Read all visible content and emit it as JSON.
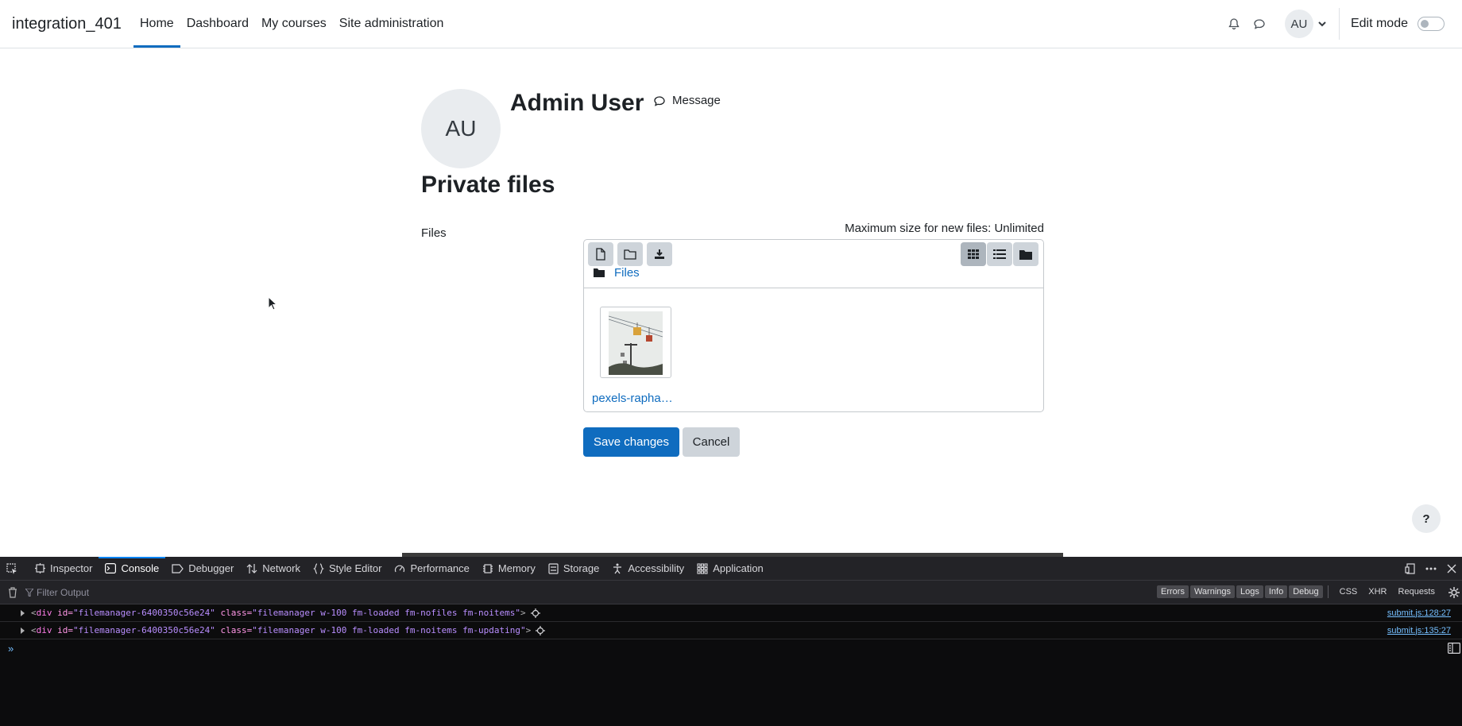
{
  "navbar": {
    "brand": "integration_401",
    "links": [
      "Home",
      "Dashboard",
      "My courses",
      "Site administration"
    ],
    "active_link": "Home",
    "user_initials": "AU",
    "edit_mode_label": "Edit mode",
    "edit_mode_on": false
  },
  "profile": {
    "initials": "AU",
    "name": "Admin User",
    "message_label": "Message"
  },
  "page": {
    "title": "Private files",
    "files_label": "Files",
    "max_size": "Maximum size for new files: Unlimited"
  },
  "filemanager": {
    "breadcrumb": "Files",
    "file_name": "pexels-rapha…",
    "view": "icons"
  },
  "buttons": {
    "save": "Save changes",
    "cancel": "Cancel",
    "help": "?"
  },
  "devtools": {
    "tabs": [
      "Inspector",
      "Console",
      "Debugger",
      "Network",
      "Style Editor",
      "Performance",
      "Memory",
      "Storage",
      "Accessibility",
      "Application"
    ],
    "active_tab": "Console",
    "filter_placeholder": "Filter Output",
    "level_filters": [
      "Errors",
      "Warnings",
      "Logs",
      "Info",
      "Debug"
    ],
    "type_filters": [
      "CSS",
      "XHR",
      "Requests"
    ],
    "messages": [
      {
        "tag": "div",
        "id": "filemanager-6400350c56e24",
        "class": "filemanager w-100 fm-loaded fm-nofiles fm-noitems",
        "location": "submit.js:128:27"
      },
      {
        "tag": "div",
        "id": "filemanager-6400350c56e24",
        "class": "filemanager w-100 fm-loaded fm-noitems fm-updating",
        "location": "submit.js:135:27"
      }
    ],
    "prompt": "»"
  }
}
